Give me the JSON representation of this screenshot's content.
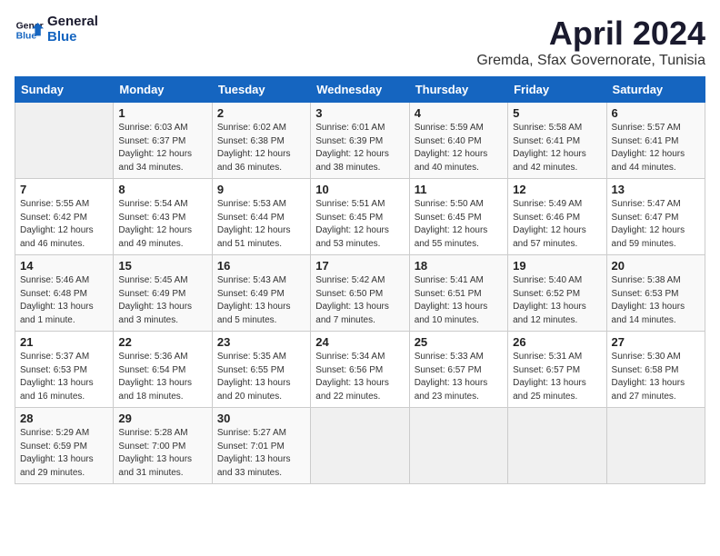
{
  "header": {
    "logo_line1": "General",
    "logo_line2": "Blue",
    "title": "April 2024",
    "subtitle": "Gremda, Sfax Governorate, Tunisia"
  },
  "weekdays": [
    "Sunday",
    "Monday",
    "Tuesday",
    "Wednesday",
    "Thursday",
    "Friday",
    "Saturday"
  ],
  "weeks": [
    [
      {
        "day": "",
        "info": ""
      },
      {
        "day": "1",
        "info": "Sunrise: 6:03 AM\nSunset: 6:37 PM\nDaylight: 12 hours\nand 34 minutes."
      },
      {
        "day": "2",
        "info": "Sunrise: 6:02 AM\nSunset: 6:38 PM\nDaylight: 12 hours\nand 36 minutes."
      },
      {
        "day": "3",
        "info": "Sunrise: 6:01 AM\nSunset: 6:39 PM\nDaylight: 12 hours\nand 38 minutes."
      },
      {
        "day": "4",
        "info": "Sunrise: 5:59 AM\nSunset: 6:40 PM\nDaylight: 12 hours\nand 40 minutes."
      },
      {
        "day": "5",
        "info": "Sunrise: 5:58 AM\nSunset: 6:41 PM\nDaylight: 12 hours\nand 42 minutes."
      },
      {
        "day": "6",
        "info": "Sunrise: 5:57 AM\nSunset: 6:41 PM\nDaylight: 12 hours\nand 44 minutes."
      }
    ],
    [
      {
        "day": "7",
        "info": "Sunrise: 5:55 AM\nSunset: 6:42 PM\nDaylight: 12 hours\nand 46 minutes."
      },
      {
        "day": "8",
        "info": "Sunrise: 5:54 AM\nSunset: 6:43 PM\nDaylight: 12 hours\nand 49 minutes."
      },
      {
        "day": "9",
        "info": "Sunrise: 5:53 AM\nSunset: 6:44 PM\nDaylight: 12 hours\nand 51 minutes."
      },
      {
        "day": "10",
        "info": "Sunrise: 5:51 AM\nSunset: 6:45 PM\nDaylight: 12 hours\nand 53 minutes."
      },
      {
        "day": "11",
        "info": "Sunrise: 5:50 AM\nSunset: 6:45 PM\nDaylight: 12 hours\nand 55 minutes."
      },
      {
        "day": "12",
        "info": "Sunrise: 5:49 AM\nSunset: 6:46 PM\nDaylight: 12 hours\nand 57 minutes."
      },
      {
        "day": "13",
        "info": "Sunrise: 5:47 AM\nSunset: 6:47 PM\nDaylight: 12 hours\nand 59 minutes."
      }
    ],
    [
      {
        "day": "14",
        "info": "Sunrise: 5:46 AM\nSunset: 6:48 PM\nDaylight: 13 hours\nand 1 minute."
      },
      {
        "day": "15",
        "info": "Sunrise: 5:45 AM\nSunset: 6:49 PM\nDaylight: 13 hours\nand 3 minutes."
      },
      {
        "day": "16",
        "info": "Sunrise: 5:43 AM\nSunset: 6:49 PM\nDaylight: 13 hours\nand 5 minutes."
      },
      {
        "day": "17",
        "info": "Sunrise: 5:42 AM\nSunset: 6:50 PM\nDaylight: 13 hours\nand 7 minutes."
      },
      {
        "day": "18",
        "info": "Sunrise: 5:41 AM\nSunset: 6:51 PM\nDaylight: 13 hours\nand 10 minutes."
      },
      {
        "day": "19",
        "info": "Sunrise: 5:40 AM\nSunset: 6:52 PM\nDaylight: 13 hours\nand 12 minutes."
      },
      {
        "day": "20",
        "info": "Sunrise: 5:38 AM\nSunset: 6:53 PM\nDaylight: 13 hours\nand 14 minutes."
      }
    ],
    [
      {
        "day": "21",
        "info": "Sunrise: 5:37 AM\nSunset: 6:53 PM\nDaylight: 13 hours\nand 16 minutes."
      },
      {
        "day": "22",
        "info": "Sunrise: 5:36 AM\nSunset: 6:54 PM\nDaylight: 13 hours\nand 18 minutes."
      },
      {
        "day": "23",
        "info": "Sunrise: 5:35 AM\nSunset: 6:55 PM\nDaylight: 13 hours\nand 20 minutes."
      },
      {
        "day": "24",
        "info": "Sunrise: 5:34 AM\nSunset: 6:56 PM\nDaylight: 13 hours\nand 22 minutes."
      },
      {
        "day": "25",
        "info": "Sunrise: 5:33 AM\nSunset: 6:57 PM\nDaylight: 13 hours\nand 23 minutes."
      },
      {
        "day": "26",
        "info": "Sunrise: 5:31 AM\nSunset: 6:57 PM\nDaylight: 13 hours\nand 25 minutes."
      },
      {
        "day": "27",
        "info": "Sunrise: 5:30 AM\nSunset: 6:58 PM\nDaylight: 13 hours\nand 27 minutes."
      }
    ],
    [
      {
        "day": "28",
        "info": "Sunrise: 5:29 AM\nSunset: 6:59 PM\nDaylight: 13 hours\nand 29 minutes."
      },
      {
        "day": "29",
        "info": "Sunrise: 5:28 AM\nSunset: 7:00 PM\nDaylight: 13 hours\nand 31 minutes."
      },
      {
        "day": "30",
        "info": "Sunrise: 5:27 AM\nSunset: 7:01 PM\nDaylight: 13 hours\nand 33 minutes."
      },
      {
        "day": "",
        "info": ""
      },
      {
        "day": "",
        "info": ""
      },
      {
        "day": "",
        "info": ""
      },
      {
        "day": "",
        "info": ""
      }
    ]
  ]
}
